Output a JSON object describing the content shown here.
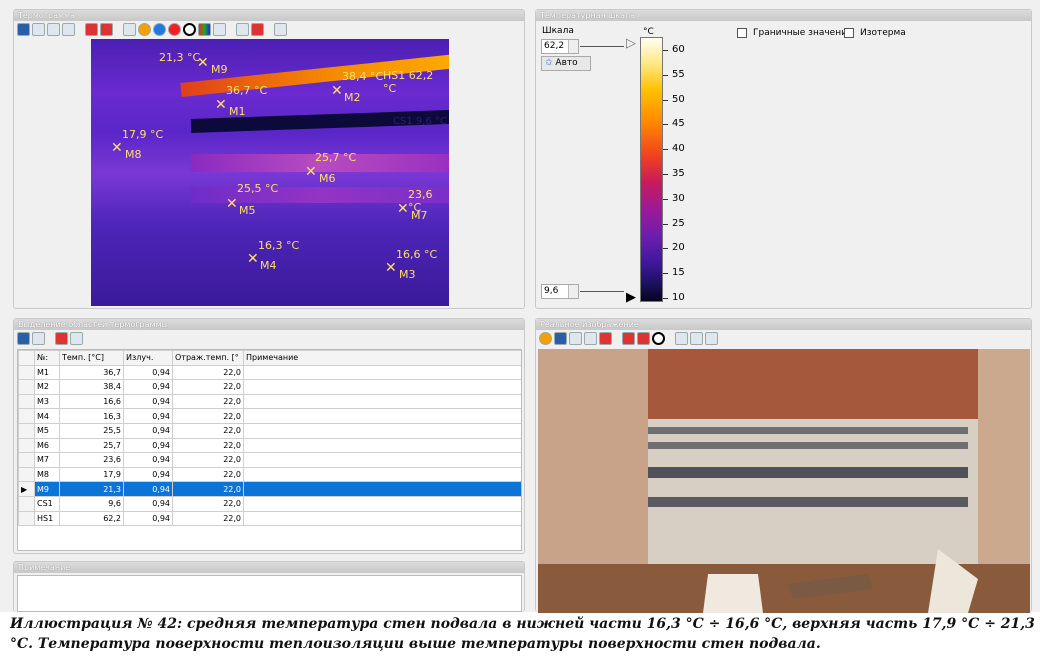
{
  "thermogram_panel": {
    "title": "Термограмма"
  },
  "scale_panel": {
    "title": "Температурная шкала",
    "scale_label": "Шкала",
    "max_value": "62,2",
    "min_value": "9,6",
    "auto_label": "Авто",
    "unit": "°C",
    "boundary_label": "Граничные значения",
    "isotherm_label": "Изотерма",
    "ticks": [
      "60",
      "55",
      "50",
      "45",
      "40",
      "35",
      "30",
      "25",
      "20",
      "15",
      "10"
    ]
  },
  "markers": [
    {
      "id": "M9",
      "temp": "21,3 °C"
    },
    {
      "id": "M1",
      "temp": "36,7 °C"
    },
    {
      "id": "M2",
      "temp": "38,4 °C"
    },
    {
      "id": "M8",
      "temp": "17,9 °C"
    },
    {
      "id": "M6",
      "temp": "25,7 °C"
    },
    {
      "id": "M5",
      "temp": "25,5 °C"
    },
    {
      "id": "M7",
      "temp": "23,6 °C"
    },
    {
      "id": "M4",
      "temp": "16,3 °C"
    },
    {
      "id": "M3",
      "temp": "16,6 °C"
    }
  ],
  "hotspot": {
    "label": "HS1 62,2 °C"
  },
  "coldspot": {
    "label": "CS1 9,6 °C"
  },
  "regions_panel": {
    "title": "Выделение областей термограммы",
    "columns": [
      "№:",
      "Темп. [°C]",
      "Излуч.",
      "Отраж.темп. [°",
      "Примечание"
    ],
    "rows": [
      [
        "M1",
        "36,7",
        "0,94",
        "22,0"
      ],
      [
        "M2",
        "38,4",
        "0,94",
        "22,0"
      ],
      [
        "M3",
        "16,6",
        "0,94",
        "22,0"
      ],
      [
        "M4",
        "16,3",
        "0,94",
        "22,0"
      ],
      [
        "M5",
        "25,5",
        "0,94",
        "22,0"
      ],
      [
        "M6",
        "25,7",
        "0,94",
        "22,0"
      ],
      [
        "M7",
        "23,6",
        "0,94",
        "22,0"
      ],
      [
        "M8",
        "17,9",
        "0,94",
        "22,0"
      ],
      [
        "M9",
        "21,3",
        "0,94",
        "22,0"
      ],
      [
        "CS1",
        "9,6",
        "0,94",
        "22,0"
      ],
      [
        "HS1",
        "62,2",
        "0,94",
        "22,0"
      ]
    ]
  },
  "note_panel": {
    "title": "Примечание"
  },
  "photo_panel": {
    "title": "Реальное изображение"
  },
  "caption": "Иллюстрация № 42: средняя температура стен подвала в нижней части 16,3 °С ÷ 16,6 °С, верхняя часть 17,9 °С ÷ 21,3 °С. Температура поверхности теплоизоляции выше температуры поверхности стен подвала."
}
